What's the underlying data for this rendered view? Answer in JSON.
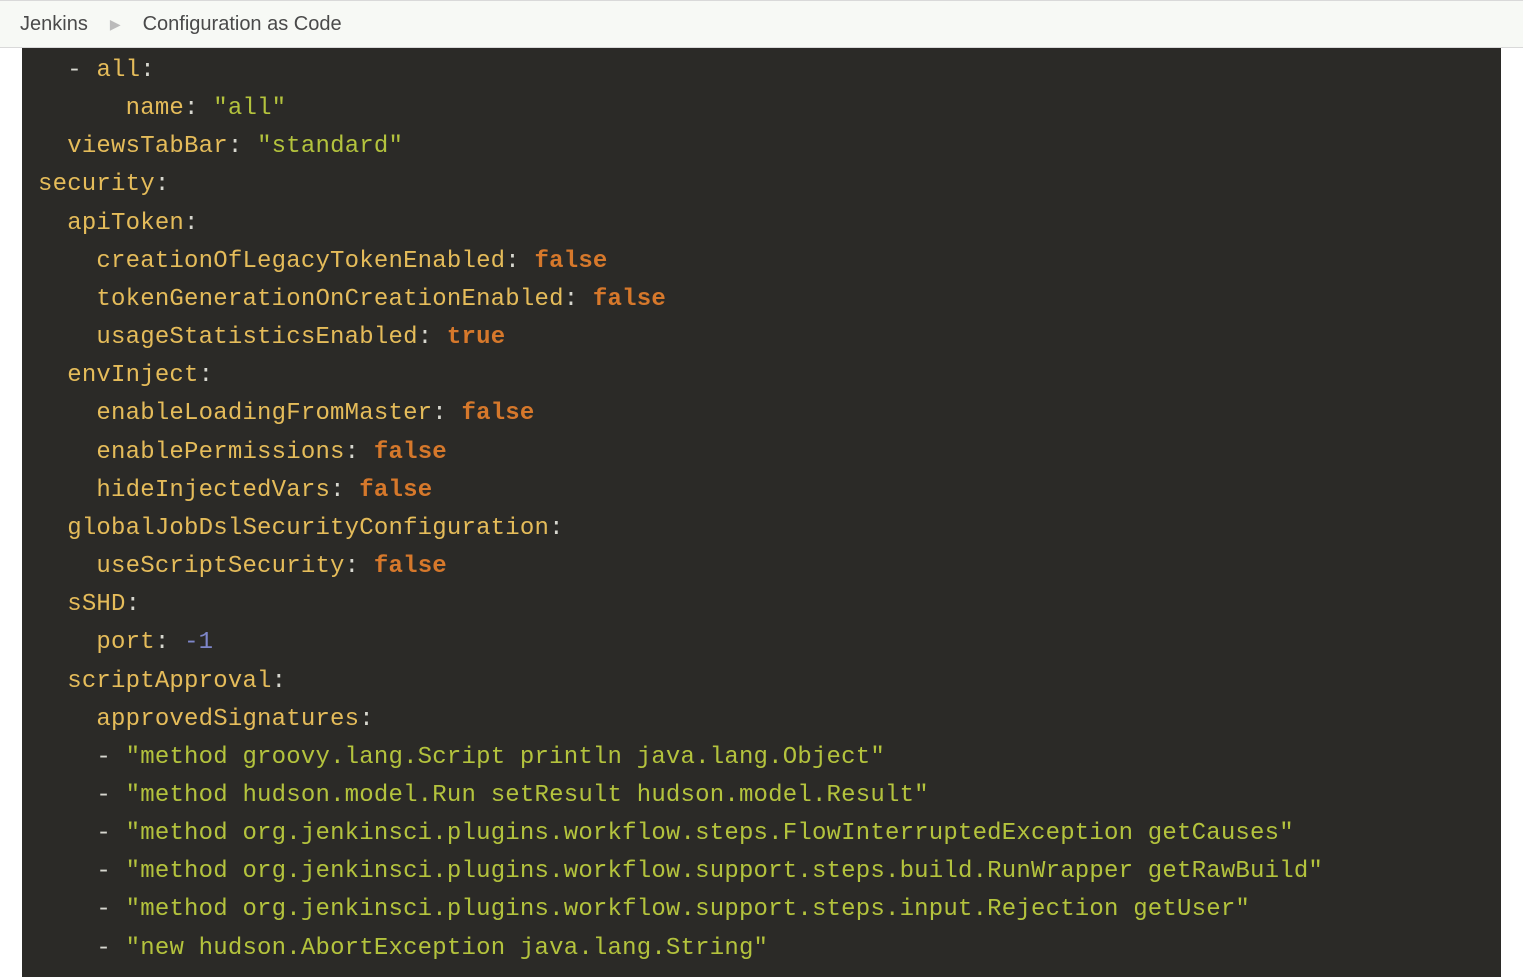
{
  "breadcrumb": {
    "items": [
      "Jenkins",
      "Configuration as Code"
    ]
  },
  "yaml": {
    "views_item_key": "all",
    "views_name_key": "name",
    "views_name_val": "\"all\"",
    "viewsTabBar_key": "viewsTabBar",
    "viewsTabBar_val": "\"standard\"",
    "security_key": "security",
    "apiToken_key": "apiToken",
    "creationOfLegacyTokenEnabled_key": "creationOfLegacyTokenEnabled",
    "creationOfLegacyTokenEnabled_val": "false",
    "tokenGenerationOnCreationEnabled_key": "tokenGenerationOnCreationEnabled",
    "tokenGenerationOnCreationEnabled_val": "false",
    "usageStatisticsEnabled_key": "usageStatisticsEnabled",
    "usageStatisticsEnabled_val": "true",
    "envInject_key": "envInject",
    "enableLoadingFromMaster_key": "enableLoadingFromMaster",
    "enableLoadingFromMaster_val": "false",
    "enablePermissions_key": "enablePermissions",
    "enablePermissions_val": "false",
    "hideInjectedVars_key": "hideInjectedVars",
    "hideInjectedVars_val": "false",
    "globalJobDslSecurityConfiguration_key": "globalJobDslSecurityConfiguration",
    "useScriptSecurity_key": "useScriptSecurity",
    "useScriptSecurity_val": "false",
    "sSHD_key": "sSHD",
    "port_key": "port",
    "port_val": "-1",
    "scriptApproval_key": "scriptApproval",
    "approvedSignatures_key": "approvedSignatures",
    "sig0": "\"method groovy.lang.Script println java.lang.Object\"",
    "sig1": "\"method hudson.model.Run setResult hudson.model.Result\"",
    "sig2": "\"method org.jenkinsci.plugins.workflow.steps.FlowInterruptedException getCauses\"",
    "sig3": "\"method org.jenkinsci.plugins.workflow.support.steps.build.RunWrapper getRawBuild\"",
    "sig4": "\"method org.jenkinsci.plugins.workflow.support.steps.input.Rejection getUser\"",
    "sig5": "\"new hudson.AbortException java.lang.String\""
  }
}
